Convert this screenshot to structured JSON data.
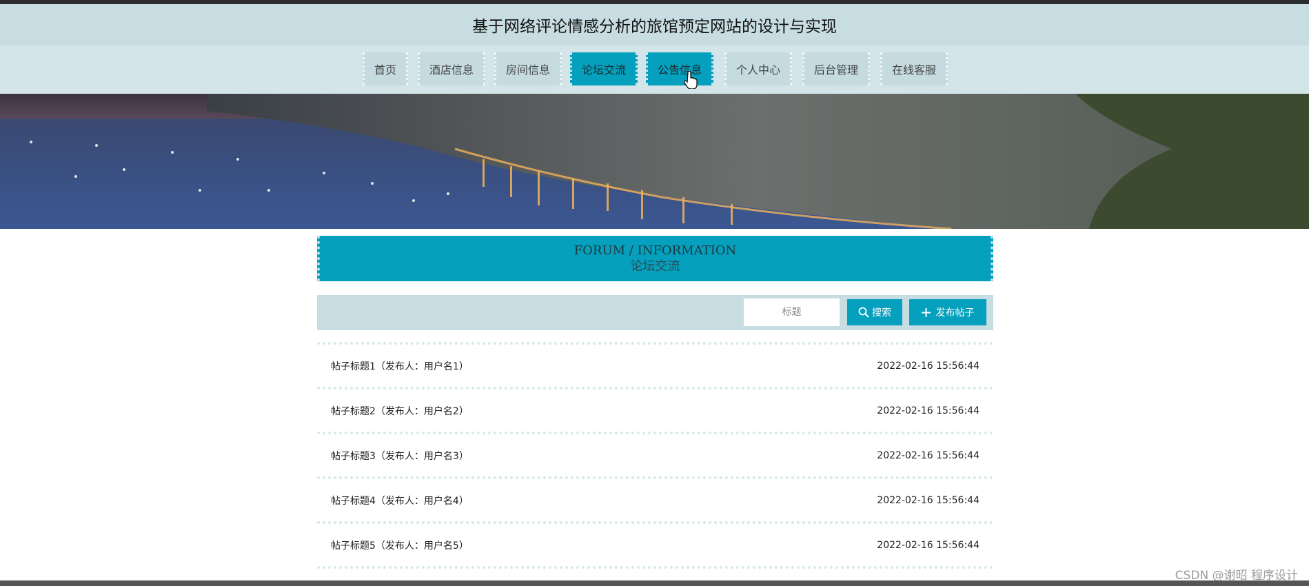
{
  "header": {
    "title": "基于网络评论情感分析的旅馆预定网站的设计与实现"
  },
  "nav": {
    "items": [
      {
        "label": "首页"
      },
      {
        "label": "酒店信息"
      },
      {
        "label": "房间信息"
      },
      {
        "label": "论坛交流"
      },
      {
        "label": "公告信息"
      },
      {
        "label": "个人中心"
      },
      {
        "label": "后台管理"
      },
      {
        "label": "在线客服"
      }
    ],
    "active": "论坛交流"
  },
  "section": {
    "title_en": "FORUM / INFORMATION",
    "title_cn": "论坛交流"
  },
  "toolbar": {
    "search_placeholder": "标题",
    "search_label": "搜索",
    "post_label": "发布帖子"
  },
  "posts": [
    {
      "title": "帖子标题1（发布人：用户名1）",
      "time": "2022-02-16 15:56:44"
    },
    {
      "title": "帖子标题2（发布人：用户名2）",
      "time": "2022-02-16 15:56:44"
    },
    {
      "title": "帖子标题3（发布人：用户名3）",
      "time": "2022-02-16 15:56:44"
    },
    {
      "title": "帖子标题4（发布人：用户名4）",
      "time": "2022-02-16 15:56:44"
    },
    {
      "title": "帖子标题5（发布人：用户名5）",
      "time": "2022-02-16 15:56:44"
    }
  ],
  "watermark": "CSDN @谢昭  程序设计",
  "colors": {
    "accent": "#04a0bd",
    "nav_bg": "#d4e5ea",
    "nav_item_bg": "#c5dbe0",
    "header_bg": "#c8dde2"
  }
}
